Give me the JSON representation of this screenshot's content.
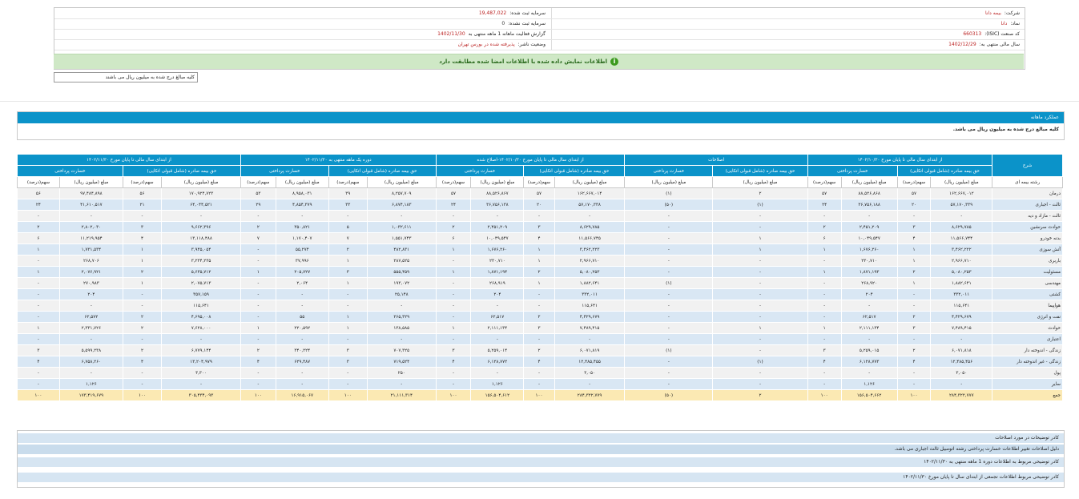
{
  "company": {
    "company_label": "شرکت:",
    "company_value": "بیمه دانا",
    "symbol_label": "نماد:",
    "symbol_value": "دانا",
    "isic_label": "کد صنعت (ISIC):",
    "isic_value": "660313",
    "fiscal_label": "سال مالی منتهی به:",
    "fiscal_value": "1402/12/29",
    "registered_capital_label": "سرمایه ثبت شده:",
    "registered_capital_value": "19,487,022",
    "unregistered_capital_label": "سرمایه ثبت نشده:",
    "unregistered_capital_value": "0",
    "report_label": "گزارش فعالیت ماهانه 1 ماهه منتهی به",
    "report_value": "1402/11/30",
    "status_label": "وضعیت ناشر:",
    "status_value": "پذیرفته شده در بورس تهران"
  },
  "notice": "اطلاعات نمایش داده شده با اطلاعات امضا شده مطابقت دارد",
  "unit_note": "کلیه مبالغ درج شده به میلیون ریال می باشند",
  "panel": {
    "title": "عملکرد ماهانه",
    "subtitle": "کلیه مبالغ درج شده به میلیون ریال می باشد."
  },
  "table": {
    "col_desc": "شرح",
    "g1": "از ابتدای سال مالی تا پایان مورخ ۱۴۰۲/۱۰/۳۰",
    "g2": "اصلاحات",
    "g3": "از ابتدای سال مالی تا پایان مورخ ۱۴۰۲/۱۰/۳۰-اصلاح شده",
    "g4": "دوره یک ماهه منتهی به ۱۴۰۲/۱۱/۳۰",
    "g5": "از ابتدای سال مالی تا پایان مورخ ۱۴۰۲/۱۱/۳۰",
    "premium": "حق بیمه صادره (شامل قبولی اتکایی)",
    "loss": "خسارت پرداختی",
    "amount": "مبلغ (میلیون ریال)",
    "share": "سهم(درصد)",
    "row_label_header": "رشته بیمه ای",
    "rows": [
      {
        "name": "درمان",
        "v": [
          "۱۶۲,۶۶۷,۰۱۲",
          "۵۷",
          "۸۸,۵۲۶,۸۶۸",
          "۵۷",
          "۲",
          "(۱)",
          "۱۶۲,۶۶۷,۰۱۴",
          "۵۷",
          "۸۸,۵۲۶,۸۶۷",
          "۵۷",
          "۸,۲۵۷,۷۰۹",
          "۳۹",
          "۸,۹۵۸,۰۳۱",
          "۵۳",
          "۱۷۰,۹۲۴,۷۲۳",
          "۵۶",
          "۹۷,۴۸۴,۸۹۸",
          "۵۶"
        ]
      },
      {
        "name": "ثالث - اجباری",
        "v": [
          "۵۷,۱۷۰,۳۳۹",
          "۲۰",
          "۳۶,۷۵۶,۱۸۸",
          "۲۴",
          "(۱)",
          "(۵۰)",
          "۵۷,۱۷۰,۳۳۸",
          "۲۰",
          "۳۶,۷۵۶,۱۳۸",
          "۲۴",
          "۶,۸۷۴,۱۸۳",
          "۳۳",
          "۴,۸۵۴,۳۷۹",
          "۲۹",
          "۶۴,۰۴۴,۵۲۱",
          "۲۱",
          "۴۱,۶۱۰,۵۱۷",
          "۲۴"
        ]
      },
      {
        "name": "ثالث - مازاد و دیه",
        "v": [
          "-",
          "-",
          "-",
          "-",
          "-",
          "-",
          "-",
          "-",
          "-",
          "-",
          "-",
          "-",
          "-",
          "-",
          "-",
          "-",
          "-",
          "-"
        ]
      },
      {
        "name": "حوادث سرنشین",
        "v": [
          "۸,۶۲۹,۷۸۵",
          "۳",
          "۲,۴۵۱,۲۰۹",
          "۲",
          "-",
          "-",
          "۸,۶۲۹,۷۸۵",
          "۳",
          "۲,۴۵۱,۲۰۹",
          "۲",
          "۱,۰۳۲,۶۱۱",
          "۵",
          "۳۵۰,۸۲۱",
          "۲",
          "۹,۶۶۲,۳۹۶",
          "۳",
          "۲,۸۰۲,۰۳۰",
          "۲"
        ]
      },
      {
        "name": "بدنه خودرو",
        "v": [
          "۱۱,۵۶۶,۷۴۴",
          "۴",
          "۱۰,۰۴۹,۵۴۷",
          "۶",
          "۱",
          "-",
          "۱۱,۵۶۶,۷۴۵",
          "۴",
          "۱۰,۰۴۹,۵۴۷",
          "۶",
          "۱,۵۵۱,۷۴۳",
          "۷",
          "۱,۱۷۰,۴۰۷",
          "۷",
          "۱۳,۱۱۸,۴۸۸",
          "۴",
          "۱۱,۲۱۹,۹۵۴",
          "۶"
        ]
      },
      {
        "name": "آتش سوزی",
        "v": [
          "۳,۴۶۲,۲۲۲",
          "۱",
          "۱,۶۷۶,۲۶۰",
          "۱",
          "۱",
          "-",
          "۳,۴۶۲,۲۲۳",
          "۱",
          "۱,۶۷۶,۲۶۰",
          "۱",
          "۴۸۲,۸۳۱",
          "۲",
          "۵۵,۲۷۴",
          "-",
          "۳,۹۴۵,۰۵۴",
          "۱",
          "۱,۷۳۱,۵۳۴",
          "۱"
        ]
      },
      {
        "name": "باربری",
        "v": [
          "۲,۹۶۶,۷۱۰",
          "۱",
          "۲۳۰,۷۱۰",
          "-",
          "-",
          "-",
          "۲,۹۶۶,۷۱۰",
          "۱",
          "۲۳۰,۷۱۰",
          "-",
          "۲۸۷,۵۲۵",
          "۱",
          "۳۷,۹۹۶",
          "-",
          "۳,۲۳۴,۲۳۵",
          "۱",
          "۲۶۸,۷۰۶",
          "-"
        ]
      },
      {
        "name": "مسئولیت",
        "v": [
          "۵,۰۸۰,۲۵۳",
          "۲",
          "۱,۸۷۱,۱۹۳",
          "۱",
          "-",
          "-",
          "۵,۰۸۰,۲۵۳",
          "۲",
          "۱,۸۷۱,۱۹۴",
          "۱",
          "۵۵۵,۴۵۹",
          "۳",
          "۲۰۵,۷۲۷",
          "۱",
          "۵,۶۳۵,۷۱۲",
          "۲",
          "۲,۰۷۶,۹۲۱",
          "۱"
        ]
      },
      {
        "name": "مهندسی",
        "v": [
          "۱,۸۸۲,۶۴۱",
          "۱",
          "۲۶۸,۹۲۰",
          "-",
          "-",
          "(۱)",
          "۱,۸۸۲,۶۴۱",
          "۱",
          "۲۶۸,۹۱۹",
          "-",
          "۱۹۳,۰۷۲",
          "۱",
          "۲,۰۶۴",
          "-",
          "۲,۰۷۵,۷۱۳",
          "۱",
          "۲۷۰,۹۸۳",
          "-"
        ]
      },
      {
        "name": "کشتی",
        "v": [
          "۳۳۲,۰۱۱",
          "-",
          "۲۰۴",
          "-",
          "-",
          "-",
          "۳۳۲,۰۱۱",
          "-",
          "۲۰۴",
          "-",
          "۲۵,۱۴۸",
          "-",
          "-",
          "-",
          "۳۵۷,۱۵۹",
          "-",
          "۲۰۴",
          "-"
        ]
      },
      {
        "name": "هواپیما",
        "v": [
          "۱۱۵,۶۴۱",
          "-",
          "-",
          "-",
          "-",
          "-",
          "۱۱۵,۶۴۱",
          "-",
          "-",
          "-",
          "-",
          "-",
          "-",
          "-",
          "۱۱۵,۶۴۱",
          "-",
          "-",
          "-"
        ]
      },
      {
        "name": "نفت و انرژی",
        "v": [
          "۴,۴۲۹,۶۷۹",
          "۲",
          "۶۲,۵۱۷",
          "-",
          "-",
          "-",
          "۴,۴۲۹,۶۷۹",
          "۲",
          "۶۲,۵۱۷",
          "-",
          "۲۶۵,۳۲۹",
          "۱",
          "۵۵",
          "-",
          "۴,۶۹۵,۰۰۸",
          "۲",
          "۶۲,۵۷۲",
          "-"
        ]
      },
      {
        "name": "حوادث",
        "v": [
          "۷,۴۸۹,۴۱۵",
          "۳",
          "۲,۱۱۱,۱۳۴",
          "۱",
          "۱",
          "-",
          "۷,۴۸۹,۴۱۵",
          "۳",
          "۲,۱۱۱,۱۳۴",
          "۱",
          "۱۳۸,۵۸۵",
          "۱",
          "۲۲۰,۵۹۲",
          "۱",
          "۷,۶۲۸,۰۰۰",
          "۲",
          "۲,۳۳۱,۷۲۶",
          "۱"
        ]
      },
      {
        "name": "اعتباری",
        "v": [
          "-",
          "-",
          "-",
          "-",
          "-",
          "-",
          "-",
          "-",
          "-",
          "-",
          "-",
          "-",
          "-",
          "-",
          "-",
          "-",
          "-",
          "-"
        ]
      },
      {
        "name": "زندگی - اندوخته دار",
        "v": [
          "۶,۰۷۱,۸۱۸",
          "۲",
          "۵,۲۵۹,۰۱۵",
          "۳",
          "-",
          "(۱)",
          "۶,۰۷۱,۸۱۹",
          "۲",
          "۵,۲۵۹,۰۱۴",
          "۳",
          "۷۰۷,۳۲۵",
          "۳",
          "۳۴۰,۲۲۴",
          "۲",
          "۶,۷۷۹,۱۴۴",
          "۲",
          "۵,۵۹۹,۲۳۸",
          "۳"
        ]
      },
      {
        "name": "زندگی - غیر اندوخته دار",
        "v": [
          "۱۲,۴۸۵,۴۵۶",
          "۴",
          "۶,۱۲۸,۷۷۳",
          "۴",
          "(۱)",
          "-",
          "۱۲,۴۸۵,۴۵۵",
          "۴",
          "۶,۱۲۸,۷۷۲",
          "۴",
          "۷۱۹,۵۲۴",
          "۳",
          "۶۲۹,۴۸۷",
          "۴",
          "۱۳,۲۰۴,۹۷۹",
          "۴",
          "۶,۷۵۸,۲۶۰",
          "۴"
        ]
      },
      {
        "name": "پول",
        "v": [
          "۳,۰۵۰",
          "-",
          "-",
          "-",
          "-",
          "-",
          "۳,۰۵۰",
          "-",
          "-",
          "-",
          "۲۵۰",
          "-",
          "-",
          "-",
          "۳,۳۰۰",
          "-",
          "-",
          "-"
        ]
      },
      {
        "name": "سایر",
        "v": [
          "-",
          "-",
          "۱,۱۲۶",
          "-",
          "-",
          "-",
          "-",
          "-",
          "۱,۱۲۶",
          "-",
          "-",
          "-",
          "-",
          "-",
          "-",
          "-",
          "۱,۱۲۶",
          "-"
        ]
      },
      {
        "name": "جمع",
        "v": [
          "۲۸۴,۳۲۲,۷۷۷",
          "۱۰۰",
          "۱۵۶,۵۰۴,۶۶۲",
          "۱۰۰",
          "۲",
          "(۵۰)",
          "۲۸۴,۳۲۲,۷۷۹",
          "۱۰۰",
          "۱۵۶,۵۰۴,۶۱۲",
          "۱۰۰",
          "۲۱,۱۱۱,۳۱۴",
          "۱۰۰",
          "۱۶,۹۱۵,۰۶۷",
          "۱۰۰",
          "۳۰۵,۴۳۴,۰۹۳",
          "۱۰۰",
          "۱۷۳,۴۱۹,۶۷۹",
          "۱۰۰"
        ]
      }
    ]
  },
  "notes": {
    "n1_title": "کادر توضیحات در مورد اصلاحات",
    "n1_text": "دلیل اصلاحات تغییر اطلاعات خسارت پرداختی رشته اتومبیل ثالث اجباری می باشد.",
    "n2_title": "کادر توضیحی مربوط به اطلاعات دوره 1 ماهه منتهی به ۱۴۰۲/۱۱/۳۰",
    "n3_title": "کادر توضیحی مربوط اطلاعات تجمعی از ابتدای سال تا پایان مورخ ۱۴۰۲/۱۱/۳۰"
  }
}
